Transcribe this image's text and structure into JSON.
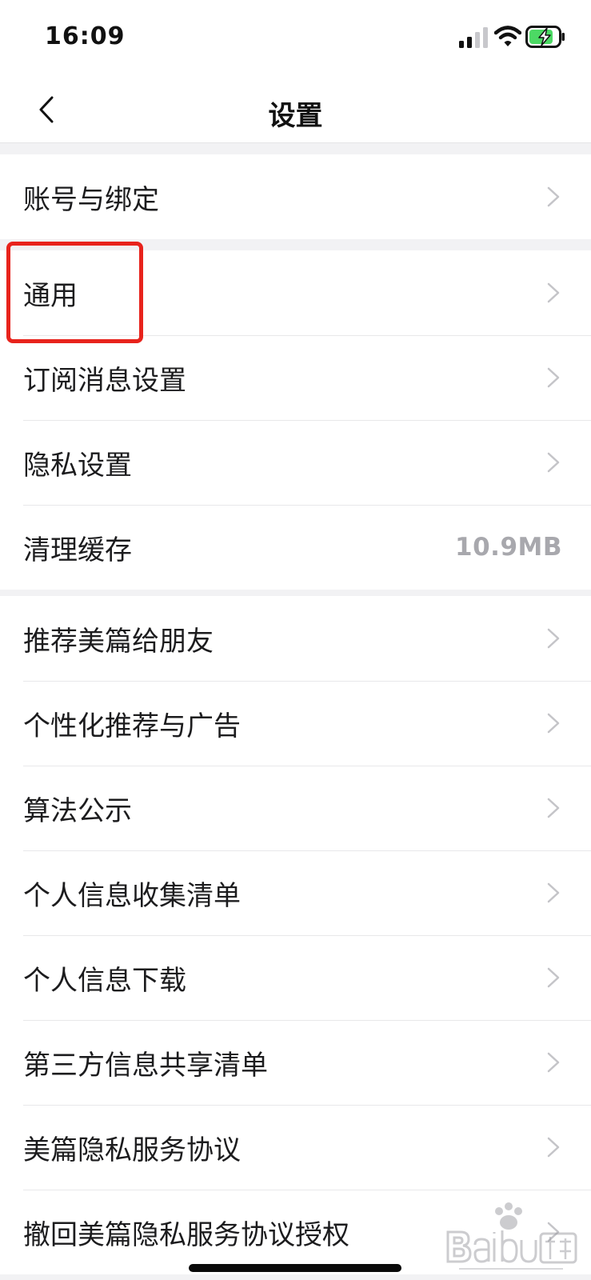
{
  "status_bar": {
    "time": "16:09"
  },
  "nav": {
    "title": "设置",
    "back_icon": "chevron-left-icon"
  },
  "groups": [
    {
      "items": [
        {
          "label": "账号与绑定"
        }
      ]
    },
    {
      "items": [
        {
          "label": "通用",
          "highlighted": true
        },
        {
          "label": "订阅消息设置"
        },
        {
          "label": "隐私设置"
        },
        {
          "label": "清理缓存",
          "value": "10.9MB"
        }
      ]
    },
    {
      "items": [
        {
          "label": "推荐美篇给朋友"
        },
        {
          "label": "个性化推荐与广告"
        },
        {
          "label": "算法公示"
        },
        {
          "label": "个人信息收集清单"
        },
        {
          "label": "个人信息下载"
        },
        {
          "label": "第三方信息共享清单"
        },
        {
          "label": "美篇隐私服务协议"
        },
        {
          "label": "撤回美篇隐私服务协议授权"
        }
      ]
    }
  ],
  "colors": {
    "highlight": "#e8231c",
    "value_text": "#a8a8ad",
    "separator": "#f2f2f4"
  },
  "watermark": {
    "brand": "Baidu经验",
    "site": "jingyan.baidu.com"
  }
}
